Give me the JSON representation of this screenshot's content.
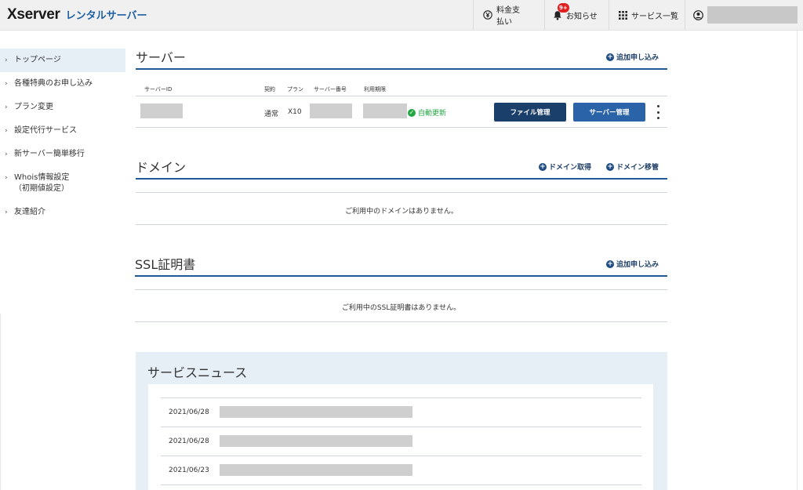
{
  "header": {
    "logo_brand": "Xserver",
    "logo_sub": "レンタルサーバー",
    "pay_label": "料金支払い",
    "notice_label": "お知らせ",
    "notice_badge": "9+",
    "services_label": "サービス一覧"
  },
  "sidebar": {
    "items": [
      {
        "label": "トップページ"
      },
      {
        "label": "各種特典のお申し込み"
      },
      {
        "label": "プラン変更"
      },
      {
        "label": "設定代行サービス"
      },
      {
        "label": "新サーバー簡単移行"
      },
      {
        "label": "Whois情報設定\n（初期値設定）"
      },
      {
        "label": "友達紹介"
      }
    ]
  },
  "server": {
    "title": "サーバー",
    "add_label": "追加申し込み",
    "columns": {
      "id": "サーバーID",
      "contract": "契約",
      "plan": "プラン",
      "number": "サーバー番号",
      "expiry": "利用期限"
    },
    "row": {
      "contract": "通常",
      "plan": "X10",
      "renew": "自動更新"
    },
    "file_button": "ファイル管理",
    "server_button": "サーバー管理"
  },
  "domain": {
    "title": "ドメイン",
    "acquire_label": "ドメイン取得",
    "transfer_label": "ドメイン移管",
    "empty": "ご利用中のドメインはありません。"
  },
  "ssl": {
    "title": "SSL証明書",
    "add_label": "追加申し込み",
    "empty": "ご利用中のSSL証明書はありません。"
  },
  "news": {
    "title": "サービスニュース",
    "items": [
      {
        "date": "2021/06/28"
      },
      {
        "date": "2021/06/28"
      },
      {
        "date": "2021/06/23"
      }
    ]
  },
  "colors": {
    "accent": "#1f5a96",
    "primary_button": "#1b3f6b",
    "secondary_button": "#2a63a8",
    "success": "#22a744",
    "badge": "#e02020"
  }
}
